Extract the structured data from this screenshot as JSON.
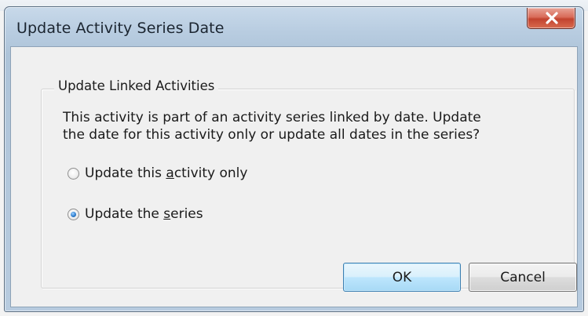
{
  "dialog": {
    "title": "Update Activity Series Date",
    "group": {
      "legend": "Update Linked Activities",
      "message_line1": "This activity is part of an activity series linked by date. Update",
      "message_line2": "the date for this activity only or update all dates in the series?"
    },
    "options": [
      {
        "label_pre": "Update this ",
        "label_key": "a",
        "label_post": "ctivity only",
        "checked": false
      },
      {
        "label_pre": "Update the ",
        "label_key": "s",
        "label_post": "eries",
        "checked": true
      }
    ],
    "buttons": {
      "ok": "OK",
      "cancel": "Cancel"
    },
    "colors": {
      "close_button": "#c2432f",
      "selected_radio": "#2f7fd0",
      "default_button_border": "#3c7fb1"
    },
    "icons": {
      "close": "close-x-icon"
    }
  }
}
